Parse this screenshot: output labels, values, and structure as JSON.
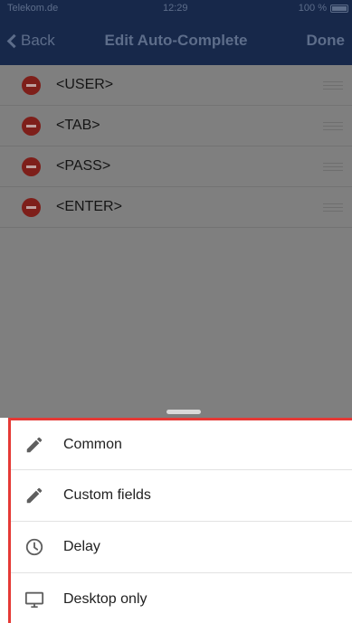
{
  "statusbar": {
    "carrier": "Telekom.de",
    "time": "12:29",
    "battery": "100 %"
  },
  "navbar": {
    "back_label": "Back",
    "title": "Edit Auto-Complete",
    "done_label": "Done"
  },
  "list": {
    "items": [
      {
        "label": "<USER>"
      },
      {
        "label": "<TAB>"
      },
      {
        "label": "<PASS>"
      },
      {
        "label": "<ENTER>"
      }
    ]
  },
  "sheet": {
    "items": [
      {
        "label": "Common",
        "icon": "pencil-icon"
      },
      {
        "label": "Custom fields",
        "icon": "pencil-icon"
      },
      {
        "label": "Delay",
        "icon": "clock-icon"
      },
      {
        "label": "Desktop only",
        "icon": "monitor-icon"
      }
    ]
  },
  "colors": {
    "navbar": "#17284a",
    "delete": "#7e1f1a",
    "highlight_border": "#e53935",
    "overlay": "#7f7f7f"
  }
}
